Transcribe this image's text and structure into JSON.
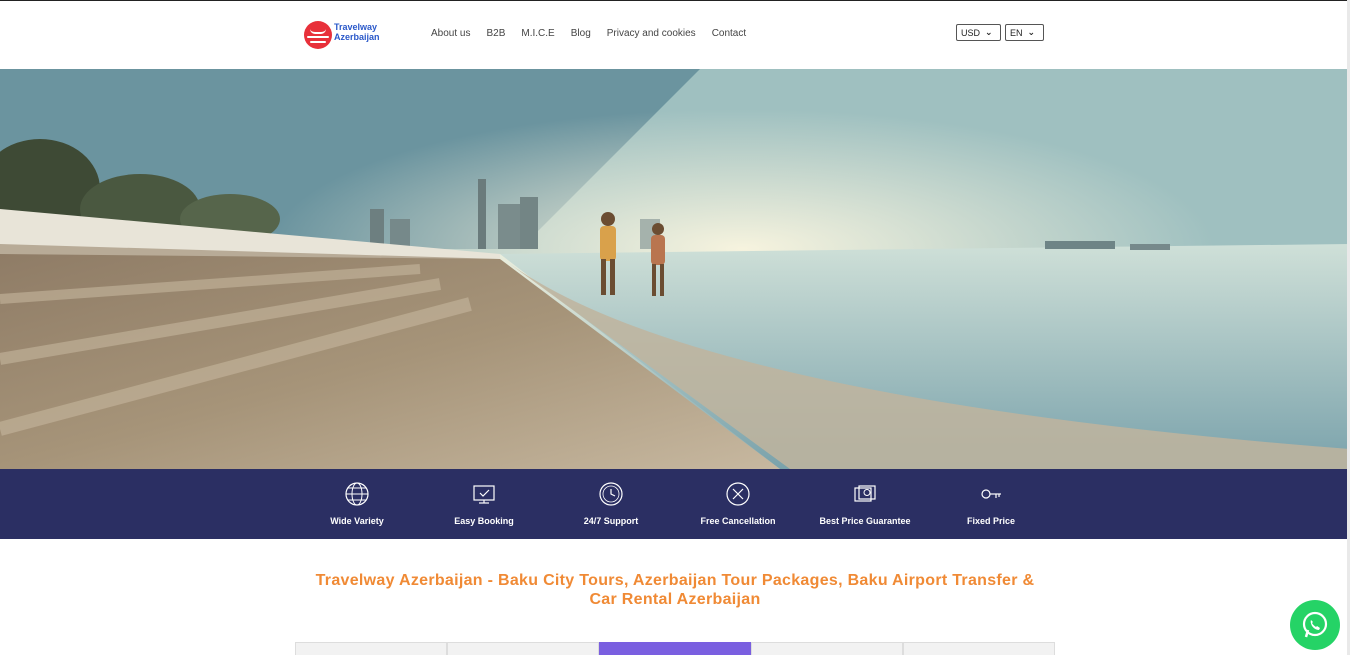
{
  "header": {
    "logo": {
      "line1": "Travelway",
      "line2": "Azerbaijan"
    },
    "nav": [
      "About us",
      "B2B",
      "M.I.C.E",
      "Blog",
      "Privacy and cookies",
      "Contact"
    ],
    "currency": "USD",
    "language": "EN"
  },
  "features": [
    {
      "label": "Wide Variety",
      "icon": "globe-icon"
    },
    {
      "label": "Easy Booking",
      "icon": "booking-icon"
    },
    {
      "label": "24/7 Support",
      "icon": "support-clock-icon"
    },
    {
      "label": "Free Cancellation",
      "icon": "cancel-x-icon"
    },
    {
      "label": "Best Price Guarantee",
      "icon": "price-tag-icon"
    },
    {
      "label": "Fixed Price",
      "icon": "key-icon"
    }
  ],
  "main": {
    "title": "Travelway Azerbaijan - Baku City Tours, Azerbaijan Tour Packages, Baku Airport Transfer & Car Rental Azerbaijan"
  },
  "colors": {
    "accent": "#f08a35",
    "features_bg": "#2b2f63",
    "tab_active": "#7a5fe0",
    "whatsapp": "#25d366",
    "logo_red": "#e8303a",
    "logo_blue": "#2a58c9"
  }
}
